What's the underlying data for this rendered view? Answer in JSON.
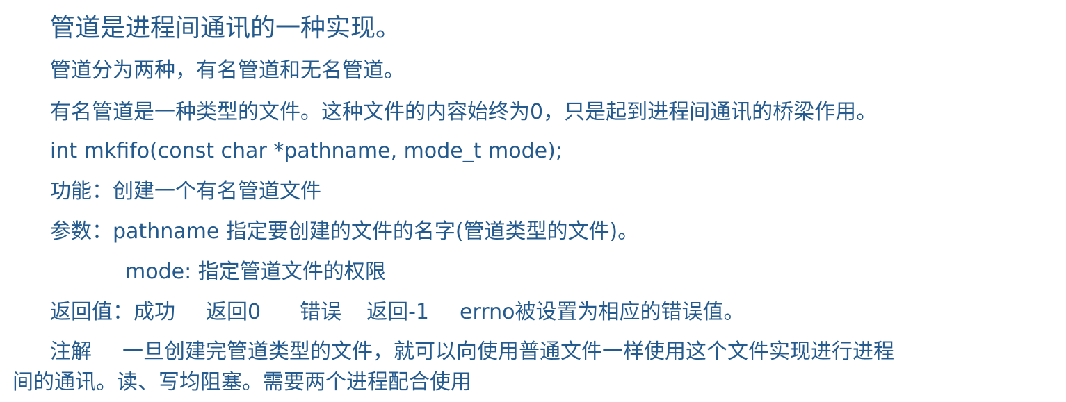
{
  "content": {
    "title": "管道是进程间通讯的一种实现。",
    "line_1": "管道分为两种，有名管道和无名管道。",
    "line_2": "有名管道是一种类型的文件。这种文件的内容始终为0，只是起到进程间通讯的桥梁作用。",
    "line_3": "int mkfifo(const char *pathname, mode_t mode);",
    "line_4": "功能：创建一个有名管道文件",
    "line_5": "参数：pathname 指定要创建的文件的名字(管道类型的文件)。",
    "line_6": "mode:  指定管道文件的权限",
    "return_label": "返回值：成功",
    "return_success": "返回0",
    "return_error_label": "错误",
    "return_error": "返回-1",
    "return_errno": "errno被设置为相应的错误值。",
    "note_label": "注解",
    "note_line_1": "一旦创建完管道类型的文件，就可以向使用普通文件一样使用这个文件实现进行进程",
    "note_line_2": "间的通讯。读、写均阻塞。需要两个进程配合使用"
  }
}
